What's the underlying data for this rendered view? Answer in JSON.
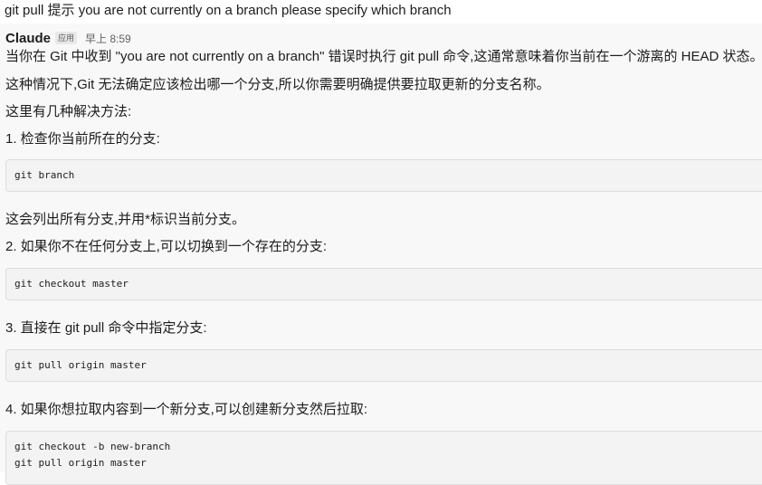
{
  "prompt": "git pull 提示 you are not currently on a branch please specify which branch",
  "message": {
    "sender": "Claude",
    "badge": "应用",
    "time": "早上 8:59",
    "paragraphs": [
      "当你在 Git 中收到 \"you are not currently on a branch\" 错误时执行 git pull 命令,这通常意味着你当前在一个游离的 HEAD 状态。",
      "这种情况下,Git 无法确定应该检出哪一个分支,所以你需要明确提供要拉取更新的分支名称。",
      "这里有几种解决方法:",
      "1. 检查你当前所在的分支:",
      "这会列出所有分支,并用*标识当前分支。",
      "2. 如果你不在任何分支上,可以切换到一个存在的分支:",
      "3. 直接在 git pull 命令中指定分支:",
      "4. 如果你想拉取内容到一个新分支,可以创建新分支然后拉取:"
    ],
    "code_blocks": [
      [
        "git branch"
      ],
      [
        "git checkout master"
      ],
      [
        "git pull origin master"
      ],
      [
        "git checkout -b new-branch",
        "git pull origin master"
      ]
    ]
  }
}
